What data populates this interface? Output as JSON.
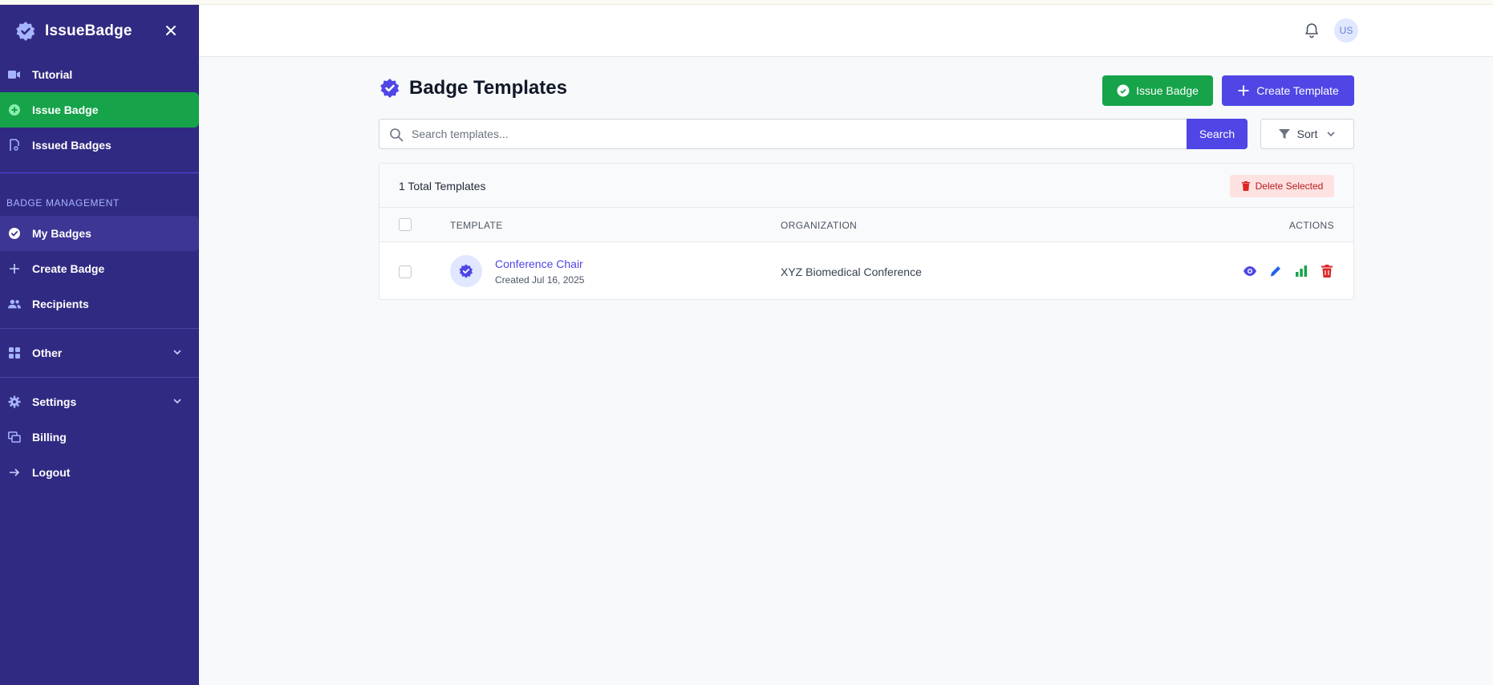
{
  "app": {
    "name": "IssueBadge"
  },
  "sidebar": {
    "top_items": [
      {
        "label": "Tutorial",
        "icon": "video-icon"
      },
      {
        "label": "Issue Badge",
        "icon": "plus-circle-icon"
      },
      {
        "label": "Issued Badges",
        "icon": "certificate-icon"
      }
    ],
    "section_title": "BADGE MANAGEMENT",
    "mgmt_items": [
      {
        "label": "My Badges",
        "icon": "check-badge-icon"
      },
      {
        "label": "Create Badge",
        "icon": "plus-icon"
      },
      {
        "label": "Recipients",
        "icon": "users-icon"
      }
    ],
    "other_label": "Other",
    "settings_label": "Settings",
    "billing_label": "Billing",
    "logout_label": "Logout"
  },
  "header": {
    "avatar_initials": "US"
  },
  "page": {
    "title": "Badge Templates",
    "issue_badge_label": "Issue Badge",
    "create_template_label": "Create Template",
    "search_placeholder": "Search templates...",
    "search_label": "Search",
    "sort_label": "Sort",
    "total_label": "1 Total Templates",
    "delete_selected_label": "Delete Selected"
  },
  "table": {
    "columns": {
      "template": "TEMPLATE",
      "organization": "ORGANIZATION",
      "actions": "ACTIONS"
    },
    "rows": [
      {
        "name": "Conference Chair",
        "created": "Created Jul 16, 2025",
        "organization": "XYZ Biomedical Conference"
      }
    ]
  },
  "colors": {
    "sidebar_bg": "#312a82",
    "accent": "#4f46e5",
    "green": "#16a34a",
    "danger": "#dc2626"
  }
}
